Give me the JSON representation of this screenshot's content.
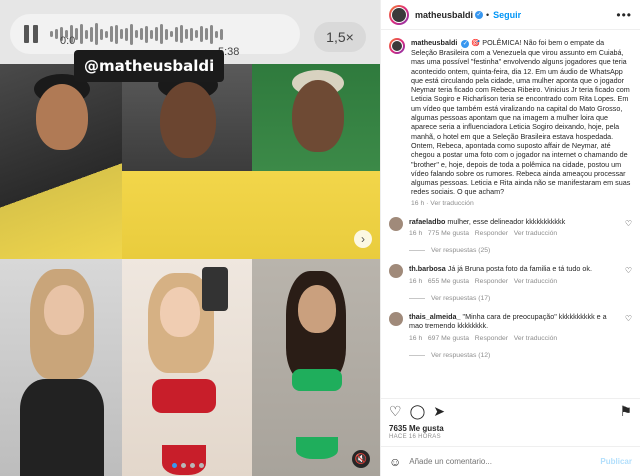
{
  "media": {
    "audio": {
      "time_elapsed": "0:0",
      "time_total": "5:38",
      "speed": "1,5×"
    },
    "overlay_tag": "@matheusbaldi",
    "mute_label": "🔇",
    "next_label": "›"
  },
  "header": {
    "username": "matheusbaldi",
    "follow_label": "Seguir",
    "more_label": "•••"
  },
  "caption": {
    "username": "matheusbaldi",
    "text": "🎯 POLÊMICA! Não foi bem o empate da Seleção Brasileira com a Venezuela que virou assunto em Cuiabá, mas uma possível \"festinha\" envolvendo alguns jogadores que teria acontecido ontem, quinta-feira, dia 12. Em um áudio de WhatsApp que está circulando pela cidade, uma mulher aponta que o jogador Neymar teria ficado com Rebeca Ribeiro. Vinicius Jr teria ficado com Leticia Sogiro e Richarlison teria se encontrado com Rita Lopes. Em um vídeo que também está viralizando na capital do Mato Grosso, algumas pessoas apontam que na imagem a mulher loira que aparece seria a influenciadora Leticia Sogiro deixando, hoje, pela manhã, o hotel em que a Seleção Brasileira estava hospedada. Ontem, Rebeca, apontada como suposto affair de Neymar, até chegou a postar uma foto com o jogador na internet o chamando de \"brother\" e, hoje, depois de toda a polêmica na cidade, postou um vídeo falando sobre os rumores. Rebeca ainda ameaçou processar algumas pessoas. Leticia e Rita ainda não se manifestaram em suas redes sociais. O que acham?",
    "time": "16 h",
    "translate": "Ver traducción"
  },
  "comments": [
    {
      "username": "rafaeladbo",
      "text": "mulher, esse delineador kkkkkkkkkkk",
      "time": "16 h",
      "likes": "775 Me gusta",
      "reply": "Responder",
      "translate": "Ver traducción",
      "replies": "Ver respuestas (25)"
    },
    {
      "username": "th.barbosa",
      "text": "Já já Bruna posta foto da familia e tá tudo ok.",
      "time": "16 h",
      "likes": "655 Me gusta",
      "reply": "Responder",
      "translate": "Ver traducción",
      "replies": "Ver respuestas (17)"
    },
    {
      "username": "thais_almeida_",
      "text": "\"Minha cara de preocupação\" kkkkkkkkkk e a mao tremendo kkkkkkkk.",
      "time": "16 h",
      "likes": "697 Me gusta",
      "reply": "Responder",
      "translate": "Ver traducción",
      "replies": "Ver respuestas (12)"
    }
  ],
  "footer": {
    "likes": "7635 Me gusta",
    "date": "HACE 16 HORAS",
    "comment_placeholder": "Añade un comentario...",
    "publish_label": "Publicar"
  },
  "colors": {
    "link_blue": "#0095f6",
    "muted_text": "#8e8e8e"
  }
}
